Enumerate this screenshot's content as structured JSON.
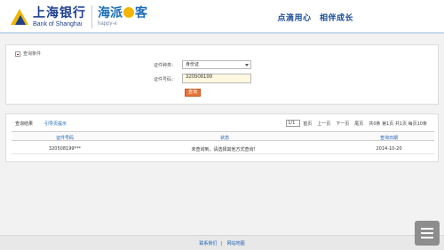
{
  "header": {
    "logo_cn": "上海银行",
    "logo_en": "Bank of Shanghai",
    "brand_cn_left": "海派",
    "brand_cn_right": "客",
    "brand_en": "happy-e",
    "slogan": "点滴用心　相伴成长"
  },
  "query_panel": {
    "title": "查询条件",
    "doc_type_label": "证件种类：",
    "doc_type_value": "身份证",
    "doc_no_label": "证件号码：",
    "doc_no_value": "320508199",
    "query_button": "查询"
  },
  "result_panel": {
    "title": "查询结果",
    "subtitle": "引导页提示",
    "pager": {
      "page_box": "1/1",
      "first": "首页",
      "prev": "上一页",
      "next": "下一页",
      "last": "尾页",
      "info": "共0条 第1页 共1页 每页10条"
    },
    "columns": [
      "证件号码",
      "状态",
      "查询日期"
    ],
    "rows": [
      [
        "320508199***",
        "未查询到，请选择其他方式查询！",
        "2014-10-20"
      ]
    ]
  },
  "footer": {
    "link1": "联系我们",
    "link2": "网站地图"
  },
  "colors": {
    "brand_blue": "#1d3f8f",
    "accent_yellow": "#f2b600",
    "button_orange": "#e8763a"
  }
}
